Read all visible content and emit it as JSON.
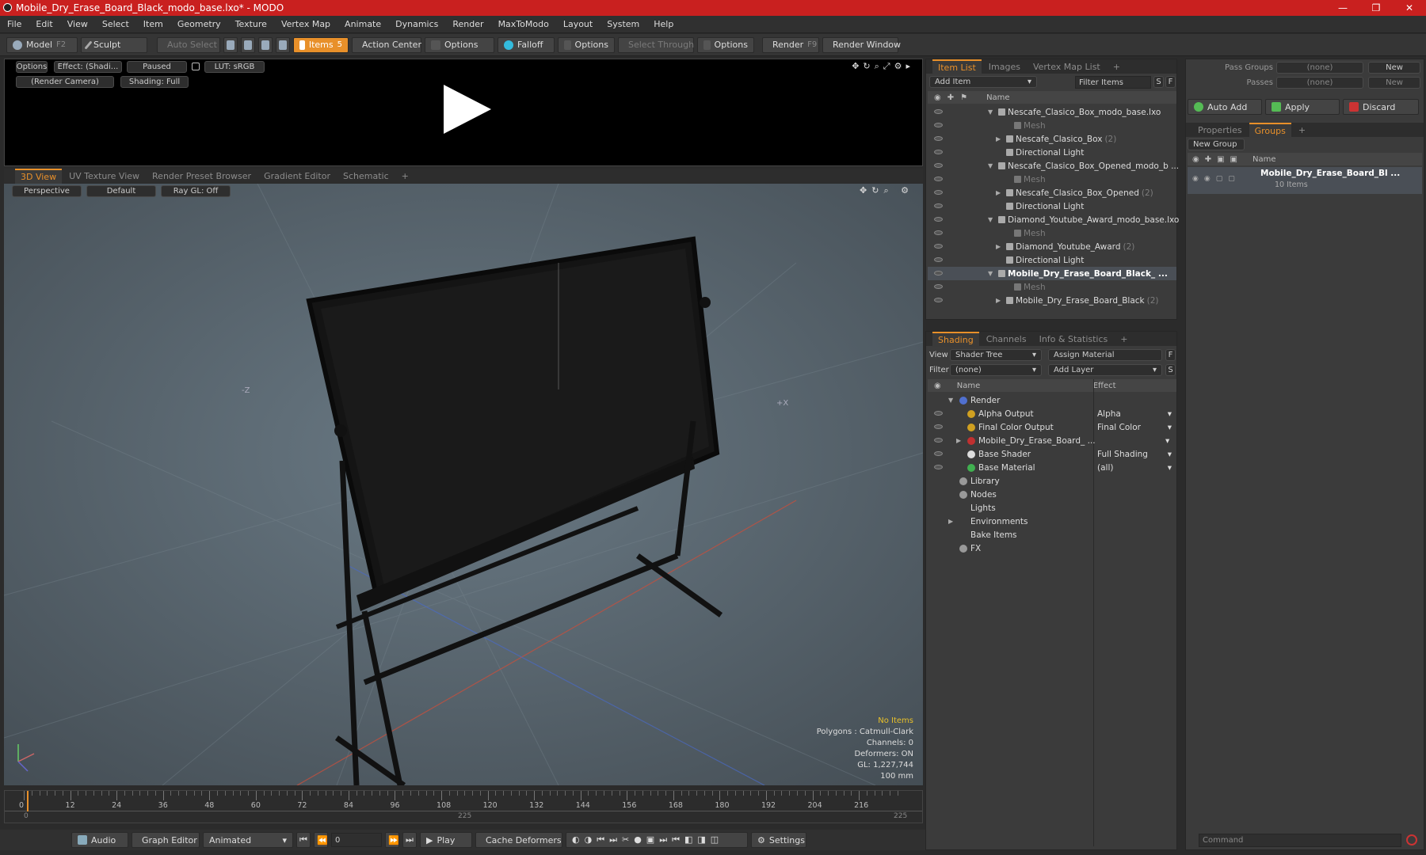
{
  "window": {
    "title": "Mobile_Dry_Erase_Board_Black_modo_base.lxo* - MODO",
    "controls": [
      "—",
      "❐",
      "✕"
    ]
  },
  "menu": [
    "File",
    "Edit",
    "View",
    "Select",
    "Item",
    "Geometry",
    "Texture",
    "Vertex Map",
    "Animate",
    "Dynamics",
    "Render",
    "MaxToModo",
    "Layout",
    "System",
    "Help"
  ],
  "toolbar": {
    "model": "Model",
    "model_key": "F2",
    "sculpt": "Sculpt",
    "auto_select": "Auto Select",
    "items": "Items",
    "items_key": "5",
    "action_center": "Action Center",
    "options1": "Options",
    "falloff": "Falloff",
    "options2": "Options",
    "select_through": "Select Through",
    "options3": "Options",
    "render": "Render",
    "render_key": "F9",
    "render_window": "Render Window"
  },
  "preview": {
    "options": "Options",
    "effect": "Effect: (Shadi...",
    "paused": "Paused",
    "lut": "LUT: sRGB",
    "camera": "(Render Camera)",
    "shading": "Shading: Full"
  },
  "viewtabs": [
    "3D View",
    "UV Texture View",
    "Render Preset Browser",
    "Gradient Editor",
    "Schematic",
    "+"
  ],
  "viewport": {
    "perspective": "Perspective",
    "default": "Default",
    "raygl": "Ray GL: Off",
    "no_items": "No Items",
    "polygons": "Polygons : Catmull-Clark",
    "channels": "Channels: 0",
    "deformers": "Deformers: ON",
    "gl": "GL: 1,227,744",
    "scale": "100 mm",
    "axis_neg_z": "-Z",
    "axis_pos_x": "+X"
  },
  "timeline": {
    "ticks": [
      "0",
      "12",
      "24",
      "36",
      "48",
      "60",
      "72",
      "84",
      "96",
      "108",
      "120",
      "132",
      "144",
      "156",
      "168",
      "180",
      "192",
      "204",
      "216"
    ],
    "start": "0",
    "mid": "225",
    "end": "225"
  },
  "bottom": {
    "audio": "Audio",
    "graph_editor": "Graph Editor",
    "animated": "Animated",
    "frame": "0",
    "play": "Play",
    "cache": "Cache Deformers",
    "settings": "Settings"
  },
  "itemlist": {
    "tabs": [
      "Item List",
      "Images",
      "Vertex Map List",
      "+"
    ],
    "add_item": "Add Item",
    "filter": "Filter Items",
    "s": "S",
    "f": "F",
    "col_name": "Name",
    "rows": [
      {
        "label": "Nescafe_Clasico_Box_modo_base.lxo",
        "indent": 0,
        "gray": false,
        "bold": false,
        "tri": "▼",
        "count": ""
      },
      {
        "label": "Mesh",
        "indent": 2,
        "gray": true,
        "bold": false,
        "tri": "",
        "count": ""
      },
      {
        "label": "Nescafe_Clasico_Box",
        "indent": 1,
        "gray": false,
        "bold": false,
        "tri": "▶",
        "count": "(2)"
      },
      {
        "label": "Directional Light",
        "indent": 1,
        "gray": false,
        "bold": false,
        "tri": "",
        "count": ""
      },
      {
        "label": "Nescafe_Clasico_Box_Opened_modo_b ...",
        "indent": 0,
        "gray": false,
        "bold": false,
        "tri": "▼",
        "count": ""
      },
      {
        "label": "Mesh",
        "indent": 2,
        "gray": true,
        "bold": false,
        "tri": "",
        "count": ""
      },
      {
        "label": "Nescafe_Clasico_Box_Opened",
        "indent": 1,
        "gray": false,
        "bold": false,
        "tri": "▶",
        "count": "(2)"
      },
      {
        "label": "Directional Light",
        "indent": 1,
        "gray": false,
        "bold": false,
        "tri": "",
        "count": ""
      },
      {
        "label": "Diamond_Youtube_Award_modo_base.lxo",
        "indent": 0,
        "gray": false,
        "bold": false,
        "tri": "▼",
        "count": ""
      },
      {
        "label": "Mesh",
        "indent": 2,
        "gray": true,
        "bold": false,
        "tri": "",
        "count": ""
      },
      {
        "label": "Diamond_Youtube_Award",
        "indent": 1,
        "gray": false,
        "bold": false,
        "tri": "▶",
        "count": "(2)"
      },
      {
        "label": "Directional Light",
        "indent": 1,
        "gray": false,
        "bold": false,
        "tri": "",
        "count": ""
      },
      {
        "label": "Mobile_Dry_Erase_Board_Black_ ...",
        "indent": 0,
        "gray": false,
        "bold": true,
        "tri": "▼",
        "count": ""
      },
      {
        "label": "Mesh",
        "indent": 2,
        "gray": true,
        "bold": false,
        "tri": "",
        "count": ""
      },
      {
        "label": "Mobile_Dry_Erase_Board_Black",
        "indent": 1,
        "gray": false,
        "bold": false,
        "tri": "▶",
        "count": "(2)"
      }
    ]
  },
  "shading": {
    "tabs": [
      "Shading",
      "Channels",
      "Info & Statistics",
      "+"
    ],
    "view_label": "View",
    "view_value": "Shader Tree",
    "assign": "Assign Material",
    "f": "F",
    "filter_label": "Filter",
    "filter_value": "(none)",
    "add_layer": "Add Layer",
    "s": "S",
    "col_name": "Name",
    "col_effect": "Effect",
    "rows": [
      {
        "label": "Render",
        "effect": "",
        "indent": 0,
        "tri": "▼",
        "eye": false,
        "icon": "render-icon"
      },
      {
        "label": "Alpha Output",
        "effect": "Alpha",
        "indent": 1,
        "tri": "",
        "eye": true,
        "icon": "output-icon"
      },
      {
        "label": "Final Color Output",
        "effect": "Final Color",
        "indent": 1,
        "tri": "",
        "eye": true,
        "icon": "output-icon"
      },
      {
        "label": "Mobile_Dry_Erase_Board_ ...",
        "effect": "",
        "indent": 1,
        "tri": "▶",
        "eye": true,
        "icon": "material-group-icon"
      },
      {
        "label": "Base Shader",
        "effect": "Full Shading",
        "indent": 1,
        "tri": "",
        "eye": true,
        "icon": "shader-icon"
      },
      {
        "label": "Base Material",
        "effect": "(all)",
        "indent": 1,
        "tri": "",
        "eye": true,
        "icon": "material-icon"
      },
      {
        "label": "Library",
        "effect": "",
        "indent": 0,
        "tri": "",
        "eye": false,
        "icon": "folder-icon"
      },
      {
        "label": "Nodes",
        "effect": "",
        "indent": 0,
        "tri": "",
        "eye": false,
        "icon": "folder-icon"
      },
      {
        "label": "Lights",
        "effect": "",
        "indent": 0,
        "tri": "",
        "eye": false,
        "icon": ""
      },
      {
        "label": "Environments",
        "effect": "",
        "indent": 0,
        "tri": "▶",
        "eye": false,
        "icon": ""
      },
      {
        "label": "Bake Items",
        "effect": "",
        "indent": 0,
        "tri": "",
        "eye": false,
        "icon": ""
      },
      {
        "label": "FX",
        "effect": "",
        "indent": 0,
        "tri": "",
        "eye": false,
        "icon": "fx-icon"
      }
    ]
  },
  "right": {
    "pass_groups": "Pass Groups",
    "pass_value": "(none)",
    "new": "New",
    "passes": "Passes",
    "passes_value": "(none)",
    "new2": "New",
    "auto_add": "Auto Add",
    "apply": "Apply",
    "discard": "Discard",
    "tabs": [
      "Properties",
      "Groups",
      "+"
    ],
    "new_group": "New Group",
    "col_name": "Name",
    "group_name": "Mobile_Dry_Erase_Board_Bl ...",
    "group_count": "10 Items",
    "command": "Command"
  },
  "colors": {
    "accent": "#e8902a",
    "titlebar": "#c9201f"
  }
}
